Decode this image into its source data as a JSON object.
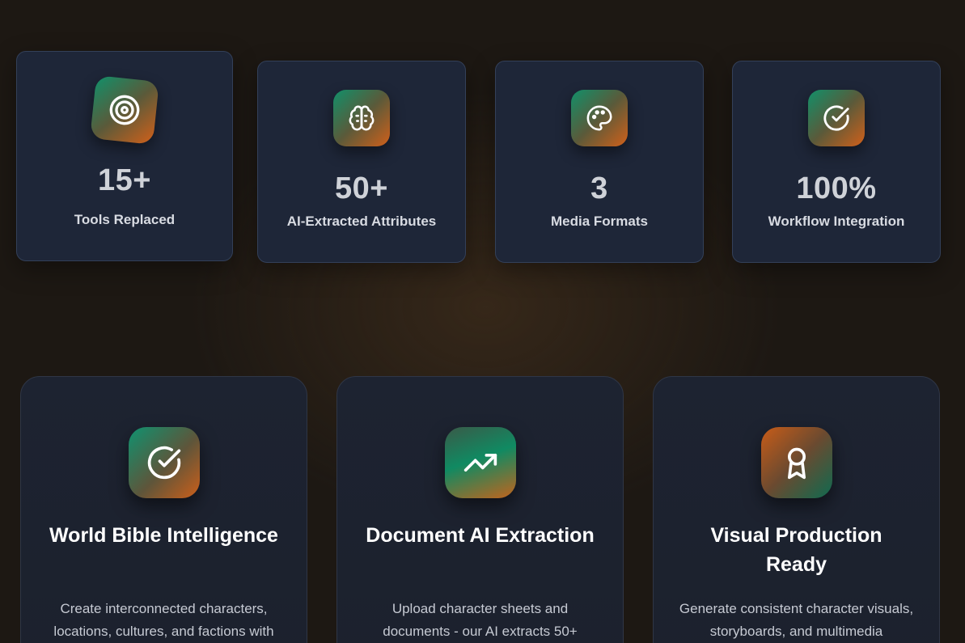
{
  "stats": [
    {
      "icon": "target-icon",
      "value": "15+",
      "label": "Tools Replaced"
    },
    {
      "icon": "brain-icon",
      "value": "50+",
      "label": "AI-Extracted Attributes"
    },
    {
      "icon": "palette-icon",
      "value": "3",
      "label": "Media Formats"
    },
    {
      "icon": "check-circle-icon",
      "value": "100%",
      "label": "Workflow Integration"
    }
  ],
  "features": [
    {
      "icon": "check-circle-icon",
      "title": "World Bible Intelligence",
      "description": "Create interconnected characters, locations, cultures, and factions with"
    },
    {
      "icon": "trending-up-icon",
      "title": "Document AI Extraction",
      "description": "Upload character sheets and documents - our AI extracts 50+"
    },
    {
      "icon": "award-icon",
      "title": "Visual Production Ready",
      "description": "Generate consistent character visuals, storyboards, and multimedia"
    }
  ],
  "colors": {
    "accent_green": "#11906a",
    "accent_orange": "#d0601a",
    "card_bg": "#1e2638"
  }
}
